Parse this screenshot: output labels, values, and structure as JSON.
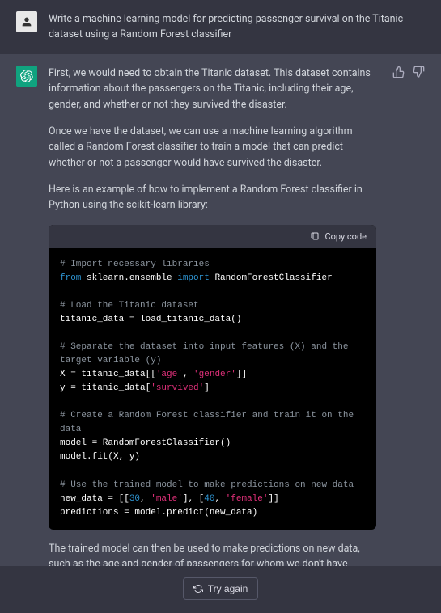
{
  "user": {
    "prompt": "Write a machine learning model for predicting passenger survival on the Titanic dataset using a Random Forest classifier"
  },
  "assistant": {
    "p1": "First, we would need to obtain the Titanic dataset. This dataset contains information about the passengers on the Titanic, including their age, gender, and whether or not they survived the disaster.",
    "p2": "Once we have the dataset, we can use a machine learning algorithm called a Random Forest classifier to train a model that can predict whether or not a passenger would have survived the disaster.",
    "p3": "Here is an example of how to implement a Random Forest classifier in Python using the scikit-learn library:",
    "p4": "The trained model can then be used to make predictions on new data, such as the age and gender of passengers for whom we don't have information about their survival."
  },
  "code": {
    "copy_label": "Copy code",
    "c1": "# Import necessary libraries",
    "kw_from": "from",
    "mod": " sklearn.ensemble ",
    "kw_import": "import",
    "cls": " RandomForestClassifier",
    "c2": "# Load the Titanic dataset",
    "l3": "titanic_data = load_titanic_data()",
    "c3": "# Separate the dataset into input features (X) and the target variable (y)",
    "l5a": "X = titanic_data[[",
    "s_age": "'age'",
    "comma": ", ",
    "s_gender": "'gender'",
    "l5b": "]]",
    "l6a": "y = titanic_data[",
    "s_survived": "'survived'",
    "l6b": "]",
    "c4": "# Create a Random Forest classifier and train it on the data",
    "l8": "model = RandomForestClassifier()",
    "l9": "model.fit(X, y)",
    "c5": "# Use the trained model to make predictions on new data",
    "l11a": "new_data = [[",
    "n30": "30",
    "s_male": "'male'",
    "brk": "], [",
    "n40": "40",
    "s_female": "'female'",
    "l11b": "]]",
    "l12": "predictions = model.predict(new_data)"
  },
  "footer": {
    "try_again": "Try again"
  }
}
